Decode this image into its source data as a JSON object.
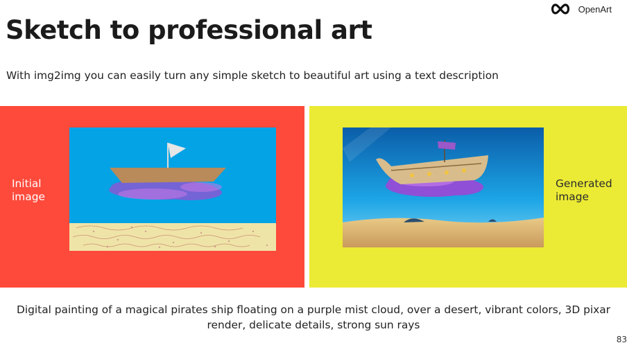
{
  "brand": {
    "name": "OpenArt",
    "logo_icon": "infinity-icon"
  },
  "title": "Sketch to professional art",
  "subtitle": "With img2img you can easily turn any simple sketch to beautiful art using a text description",
  "panels": {
    "left": {
      "label_line1": "Initial",
      "label_line2": "image",
      "background": "#fe4a3b"
    },
    "right": {
      "label_line1": "Generated",
      "label_line2": "image",
      "background": "#ebea35"
    }
  },
  "caption": {
    "line1": "Digital painting of a magical pirates ship floating on a purple mist cloud, over a desert, vibrant colors, 3D pixar",
    "line2": "render, delicate details, strong sun rays"
  },
  "page_number": "83"
}
